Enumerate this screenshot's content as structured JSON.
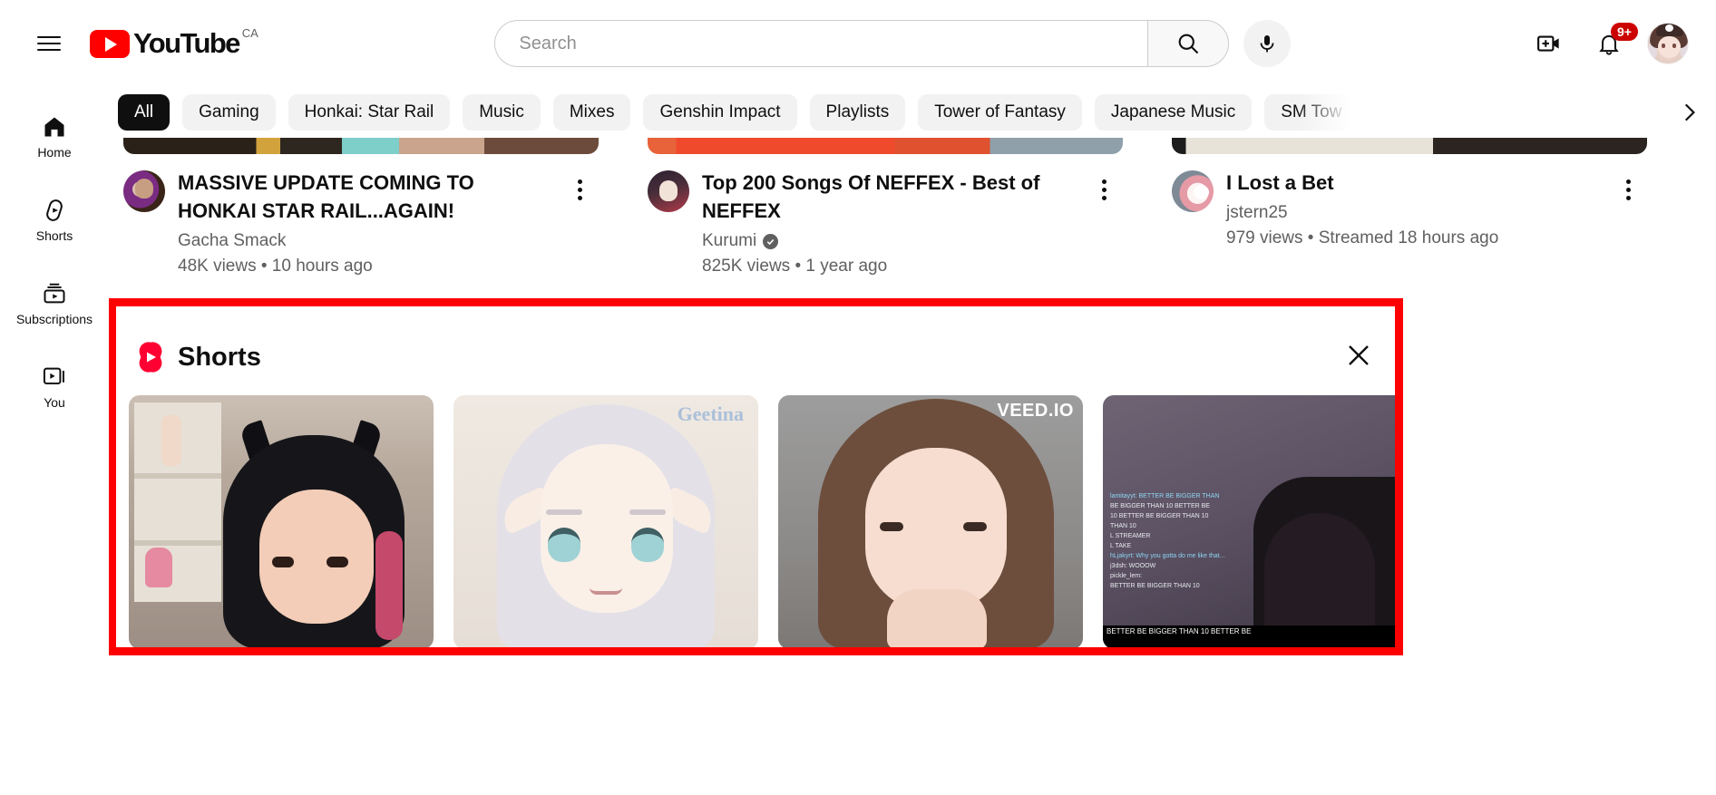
{
  "header": {
    "menu_icon": "hamburger-menu-icon",
    "logo_text": "YouTube",
    "logo_country": "CA",
    "search": {
      "value": "",
      "placeholder": "Search",
      "button_icon": "search-icon"
    },
    "mic_icon": "microphone-icon",
    "create_icon": "create-video-icon",
    "notifications_icon": "notification-bell-icon",
    "notifications_badge": "9+",
    "avatar_alt": "user-avatar"
  },
  "sidebar": {
    "items": [
      {
        "label": "Home",
        "icon": "home-icon",
        "active": true
      },
      {
        "label": "Shorts",
        "icon": "shorts-icon",
        "active": false
      },
      {
        "label": "Subscriptions",
        "icon": "subscriptions-icon",
        "active": false
      },
      {
        "label": "You",
        "icon": "you-icon",
        "active": false
      }
    ]
  },
  "chips": {
    "items": [
      {
        "label": "All",
        "active": true
      },
      {
        "label": "Gaming",
        "active": false
      },
      {
        "label": "Honkai: Star Rail",
        "active": false
      },
      {
        "label": "Music",
        "active": false
      },
      {
        "label": "Mixes",
        "active": false
      },
      {
        "label": "Genshin Impact",
        "active": false
      },
      {
        "label": "Playlists",
        "active": false
      },
      {
        "label": "Tower of Fantasy",
        "active": false
      },
      {
        "label": "Japanese Music",
        "active": false
      },
      {
        "label": "SM Tow",
        "active": false
      }
    ],
    "next_arrow_icon": "chevron-right-icon"
  },
  "videos": [
    {
      "title": "MASSIVE UPDATE COMING TO HONKAI STAR RAIL...AGAIN!",
      "channel": "Gacha Smack",
      "verified": false,
      "stats": "48K views • 10 hours ago",
      "menu_icon": "kebab-menu-icon"
    },
    {
      "title": "Top 200 Songs Of NEFFEX - Best of NEFFEX",
      "channel": "Kurumi",
      "verified": true,
      "stats": "825K views • 1 year ago",
      "menu_icon": "kebab-menu-icon"
    },
    {
      "title": "I Lost a Bet",
      "channel": "jstern25",
      "verified": false,
      "stats": "979 views • Streamed 18 hours ago",
      "menu_icon": "kebab-menu-icon"
    }
  ],
  "shorts_shelf": {
    "title": "Shorts",
    "logo_icon": "shorts-logo-icon",
    "close_icon": "close-icon",
    "highlight_color": "#ff0000",
    "items": [
      {
        "watermark": ""
      },
      {
        "watermark": "Geetina"
      },
      {
        "watermark": "VEED.IO"
      },
      {
        "watermark": ""
      }
    ],
    "chat_lines": [
      "lamitayyt: BETTER BE BIGGER THAN",
      "BE BIGGER THAN 10 BETTER BE",
      "10 BETTER BE BIGGER THAN 10",
      "THAN 10",
      "L STREAMER",
      "L TAKE",
      "hLjakyrt: Why you gotta do me like that...",
      "j3dsh: WOOOW",
      "pickle_lem:",
      "BETTER BE BIGGER THAN 10"
    ],
    "banner_text": "BETTER BE BIGGER THAN 10 BETTER BE"
  },
  "colors": {
    "brand_red": "#ff0000",
    "badge_red": "#cc0000",
    "text_primary": "#0f0f0f",
    "text_secondary": "#606060",
    "chip_bg": "#f2f2f2"
  }
}
